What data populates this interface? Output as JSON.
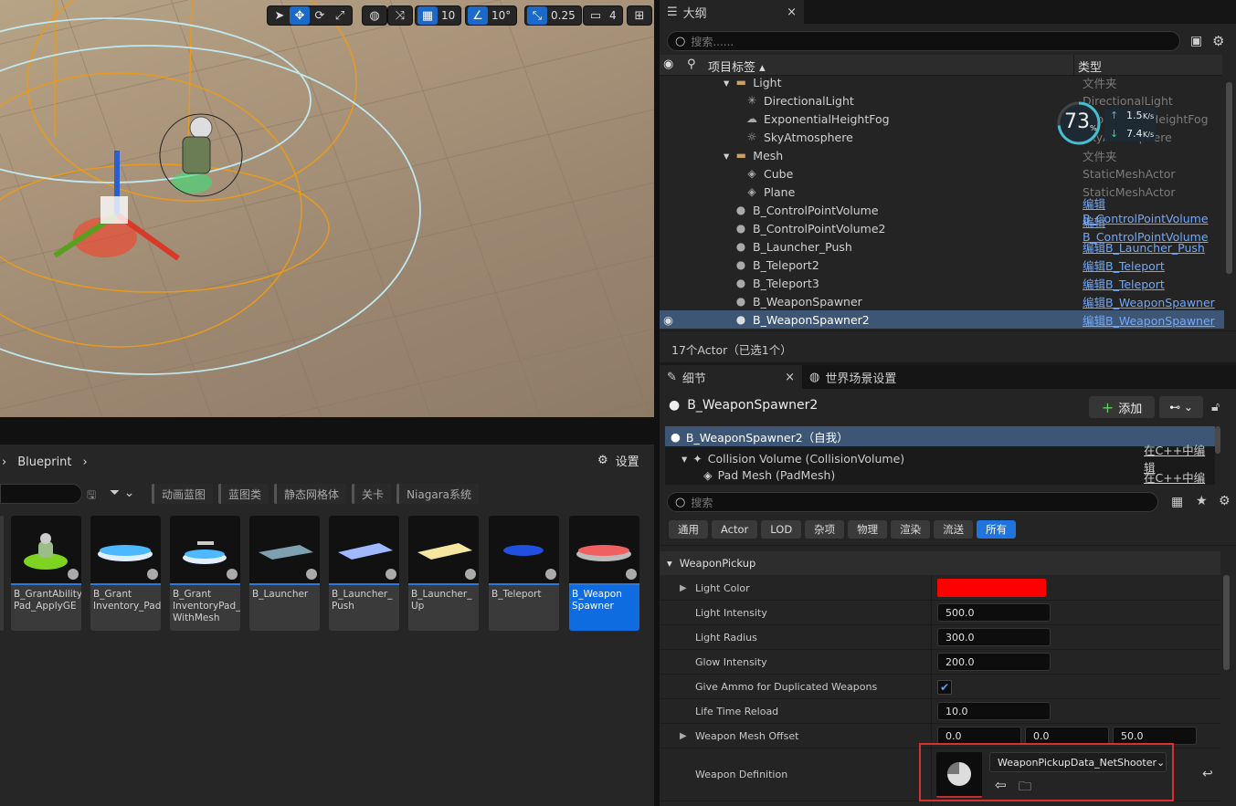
{
  "viewport": {
    "toolbar": {
      "grid_snap": "10",
      "rot_snap": "10°",
      "scale_snap": "0.25",
      "cam_speed": "4"
    }
  },
  "outliner": {
    "tab_title": "大纲",
    "search_placeholder": "搜索......",
    "col_label": "项目标签",
    "col_type": "类型",
    "rows": [
      {
        "name": "Light",
        "type": "文件夹"
      },
      {
        "name": "DirectionalLight",
        "type": "DirectionalLight"
      },
      {
        "name": "ExponentialHeightFog",
        "type": "ExponentialHeightFog"
      },
      {
        "name": "SkyAtmosphere",
        "type": "SkyAtmosphere"
      },
      {
        "name": "Mesh",
        "type": "文件夹"
      },
      {
        "name": "Cube",
        "type": "StaticMeshActor"
      },
      {
        "name": "Plane",
        "type": "StaticMeshActor"
      },
      {
        "name": "B_ControlPointVolume",
        "type": "编辑B_ControlPointVolume"
      },
      {
        "name": "B_ControlPointVolume2",
        "type": "编辑B_ControlPointVolume"
      },
      {
        "name": "B_Launcher_Push",
        "type": "编辑B_Launcher_Push"
      },
      {
        "name": "B_Teleport2",
        "type": "编辑B_Teleport"
      },
      {
        "name": "B_Teleport3",
        "type": "编辑B_Teleport"
      },
      {
        "name": "B_WeaponSpawner",
        "type": "编辑B_WeaponSpawner"
      },
      {
        "name": "B_WeaponSpawner2",
        "type": "编辑B_WeaponSpawner"
      }
    ],
    "status": "17个Actor（已选1个）"
  },
  "net_widget": {
    "percent": "73",
    "percent_unit": "%",
    "up": "1.5",
    "down": "7.4",
    "unit": "K/s"
  },
  "details": {
    "tab_title": "细节",
    "tab_world": "世界场景设置",
    "actor_name": "B_WeaponSpawner2",
    "add_label": "添加",
    "components": [
      {
        "name": "B_WeaponSpawner2（自我）",
        "edit": ""
      },
      {
        "name": "Collision Volume (CollisionVolume)",
        "edit": "在C++中编辑"
      },
      {
        "name": "Pad Mesh (PadMesh)",
        "edit": "在C++中编辑"
      }
    ],
    "search_placeholder": "搜索",
    "categories": [
      "通用",
      "Actor",
      "LOD",
      "杂项",
      "物理",
      "渲染",
      "流送",
      "所有"
    ],
    "section": "WeaponPickup",
    "props": [
      {
        "label": "Light Color",
        "value": ""
      },
      {
        "label": "Light Intensity",
        "value": "500.0"
      },
      {
        "label": "Light Radius",
        "value": "300.0"
      },
      {
        "label": "Glow Intensity",
        "value": "200.0"
      },
      {
        "label": "Give Ammo for Duplicated Weapons",
        "value": ""
      },
      {
        "label": "Life Time Reload",
        "value": "10.0"
      },
      {
        "label": "Weapon Mesh Offset",
        "value": ""
      }
    ],
    "offset": [
      "0.0",
      "0.0",
      "50.0"
    ],
    "weapon_def_label": "Weapon Definition",
    "weapon_def_value": "WeaponPickupData_NetShooter",
    "light_color": "#ff0000"
  },
  "content": {
    "breadcrumb": "Blueprint",
    "settings": "设置",
    "filters": [
      "动画蓝图",
      "蓝图类",
      "静态网格体",
      "关卡",
      "Niagara系统"
    ],
    "assets": [
      "B_GrantAbility\nPad_ApplyGE",
      "B_Grant\nInventory_Pad",
      "B_Grant\nInventoryPad_\nWithMesh",
      "B_Launcher",
      "B_Launcher_\nPush",
      "B_Launcher_\nUp",
      "B_Teleport",
      "B_Weapon\nSpawner"
    ]
  }
}
